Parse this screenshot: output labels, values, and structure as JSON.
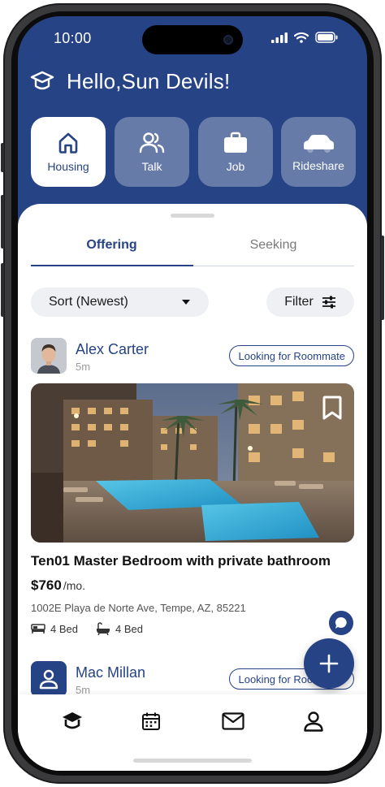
{
  "status_bar": {
    "time": "10:00"
  },
  "header": {
    "greeting": "Hello,Sun Devils!"
  },
  "categories": [
    {
      "label": "Housing",
      "icon": "house-icon",
      "active": true
    },
    {
      "label": "Talk",
      "icon": "people-icon",
      "active": false
    },
    {
      "label": "Job",
      "icon": "briefcase-icon",
      "active": false
    },
    {
      "label": "Rideshare",
      "icon": "car-icon",
      "active": false
    }
  ],
  "tabs": [
    {
      "label": "Offering",
      "active": true
    },
    {
      "label": "Seeking",
      "active": false
    }
  ],
  "controls": {
    "sort_label": "Sort (Newest)",
    "filter_label": "Filter"
  },
  "posts": [
    {
      "author": "Alex Carter",
      "time_ago": "5m",
      "badge": "Looking for Roommate",
      "title": "Ten01 Master Bedroom with private bathroom",
      "price": "$760",
      "price_unit": "/mo.",
      "address": "1002E Playa de Norte Ave, Tempe, AZ, 85221",
      "beds": "4 Bed",
      "baths": "4 Bed"
    },
    {
      "author": "Mac Millan",
      "time_ago": "5m",
      "badge": "Looking for Roommate"
    }
  ],
  "bottom_nav": [
    {
      "icon": "graduation-cap-icon"
    },
    {
      "icon": "calendar-icon"
    },
    {
      "icon": "mail-icon"
    },
    {
      "icon": "profile-icon"
    }
  ],
  "colors": {
    "primary": "#264385",
    "chip_bg": "#eef0f3",
    "white": "#ffffff"
  }
}
